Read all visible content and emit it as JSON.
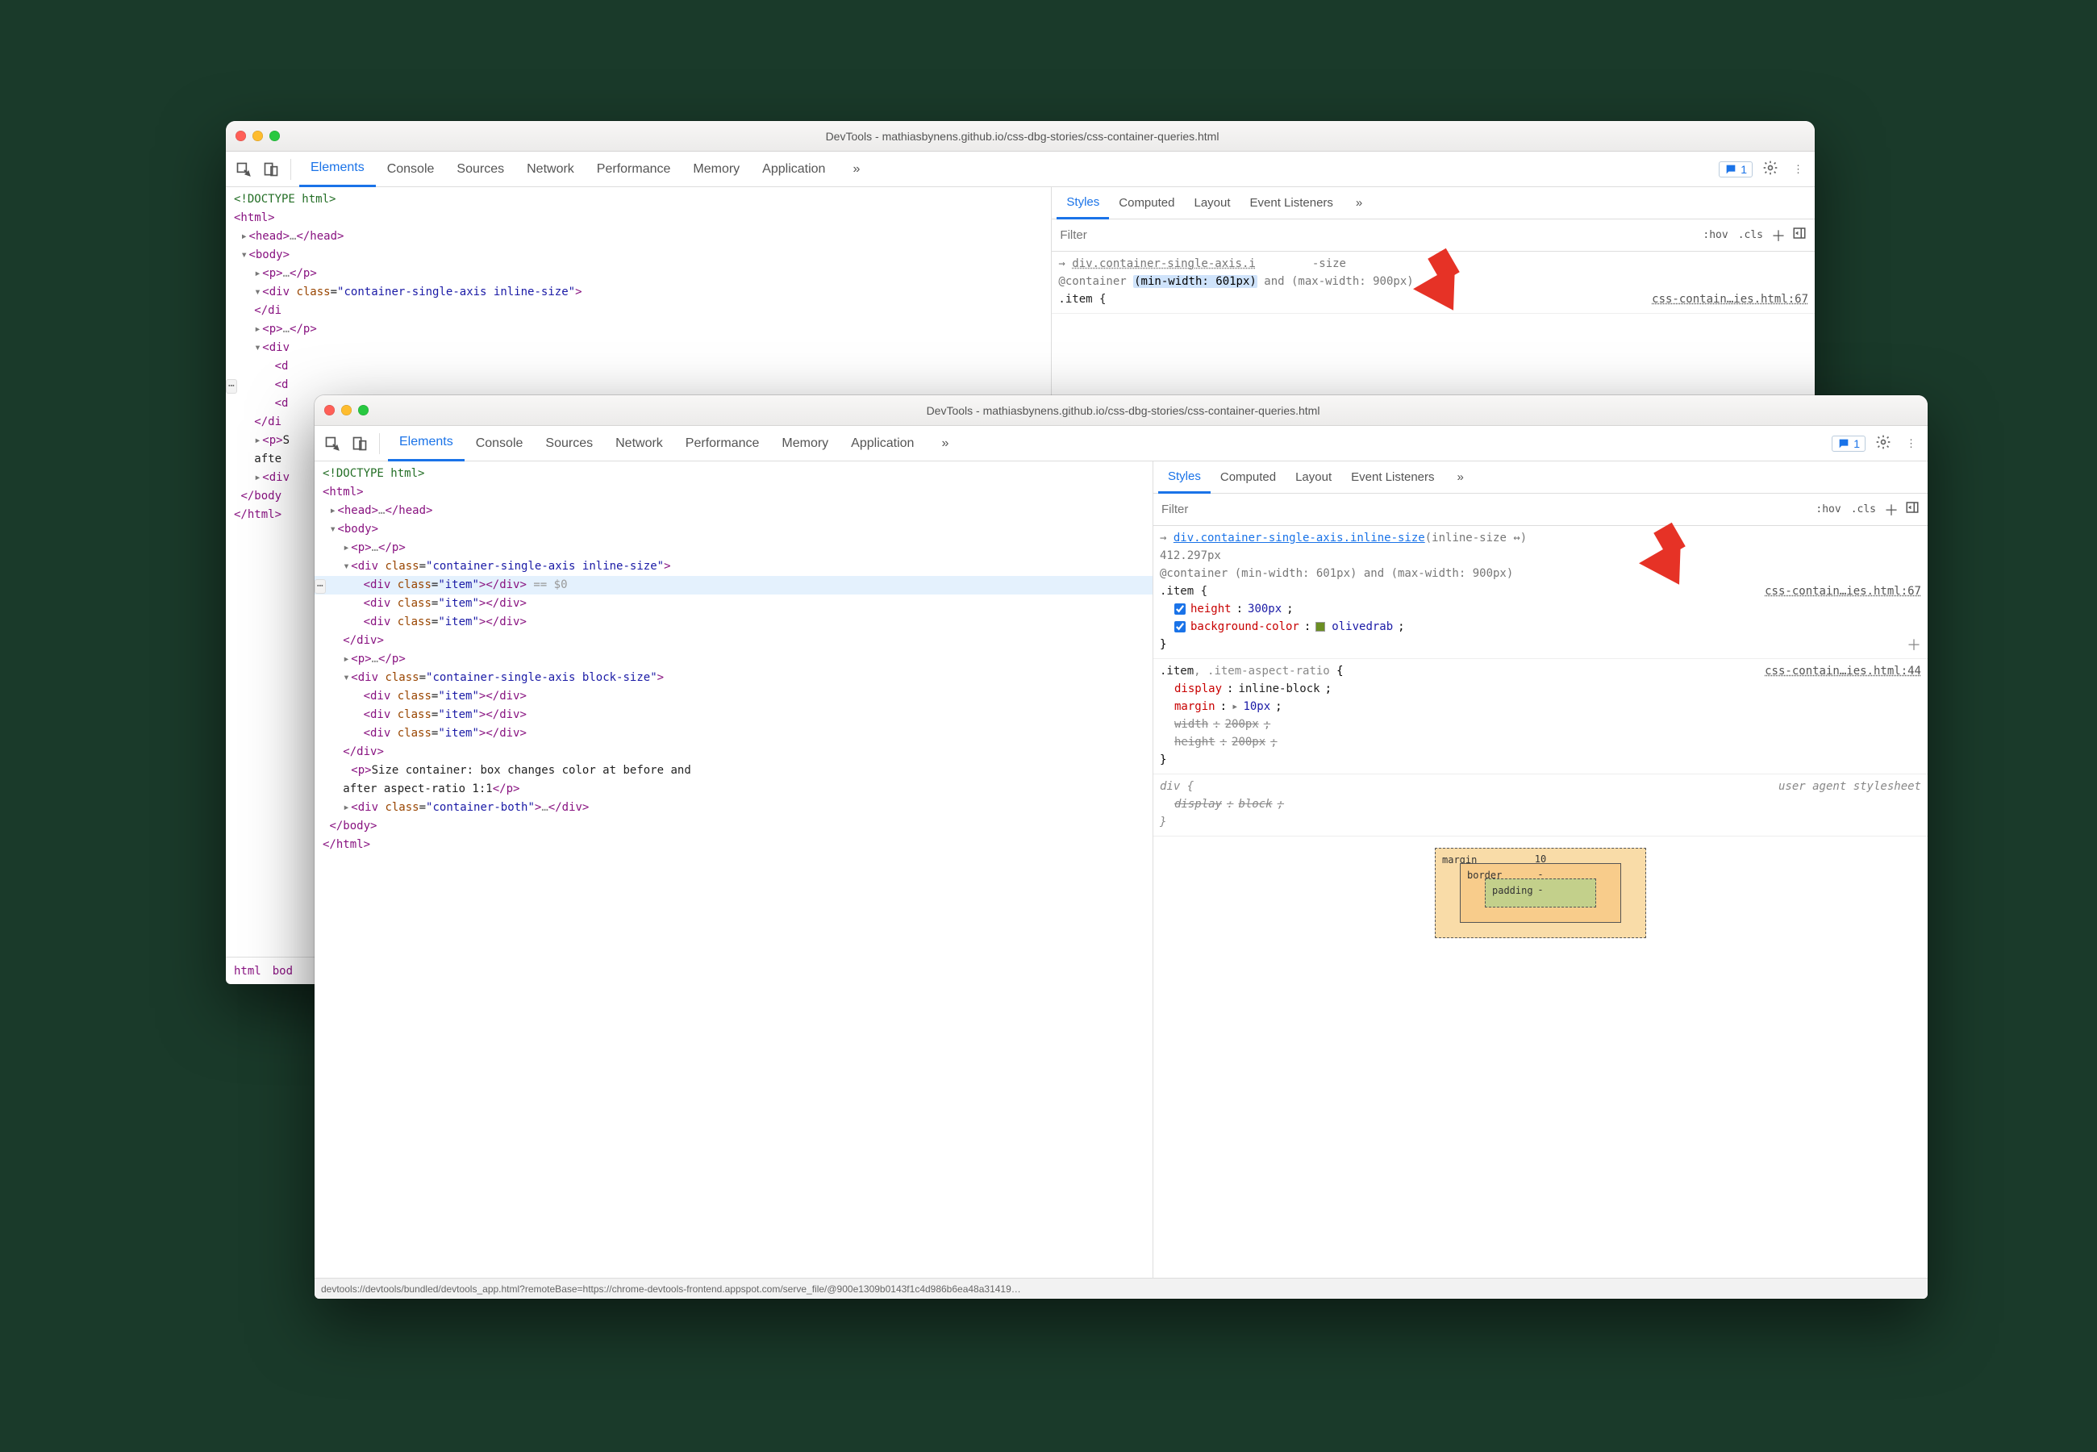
{
  "window_back": {
    "title": "DevTools - mathiasbynens.github.io/css-dbg-stories/css-container-queries.html",
    "tabs": [
      "Elements",
      "Console",
      "Sources",
      "Network",
      "Performance",
      "Memory",
      "Application"
    ],
    "active_tab": "Elements",
    "messages": "1",
    "subtabs": [
      "Styles",
      "Computed",
      "Layout",
      "Event Listeners"
    ],
    "active_subtab": "Styles",
    "filter_placeholder": "Filter",
    "hov": ":hov",
    "cls": ".cls",
    "tree": {
      "doctype": "<!DOCTYPE html>",
      "html_open": "<html>",
      "head": "<head>…</head>",
      "body_open": "<body>",
      "p_empty": "<p>…</p>",
      "div1_open": "<div class=\"container-single-axis inline-size\">",
      "close_di": "</di",
      "div_open_only": "<div",
      "close_div": "</div>",
      "p_s": "<p>S",
      "afte": "afte",
      "body_close": "</body",
      "html_close": "</html>"
    },
    "crumbs": [
      "html",
      "bod"
    ],
    "styles": {
      "origin": "div.container-single-axis.i",
      "origin_tail": "-size",
      "container_rule": "@container (min-width: 601px) and (max-width: 900px)",
      "selector_open": ".item {",
      "src": "css-contain…ies.html:67",
      "hl_fragment": "(min-width: 601px)"
    }
  },
  "window_front": {
    "title": "DevTools - mathiasbynens.github.io/css-dbg-stories/css-container-queries.html",
    "tabs": [
      "Elements",
      "Console",
      "Sources",
      "Network",
      "Performance",
      "Memory",
      "Application"
    ],
    "active_tab": "Elements",
    "messages": "1",
    "subtabs": [
      "Styles",
      "Computed",
      "Layout",
      "Event Listeners"
    ],
    "active_subtab": "Styles",
    "filter_placeholder": "Filter",
    "hov": ":hov",
    "cls": ".cls",
    "tree": {
      "doctype": "<!DOCTYPE html>",
      "html_open": "<html>",
      "head": "<head>…</head>",
      "body_open": "<body>",
      "p_empty": "<p>…</p>",
      "div1_open": "<div class=\"container-single-axis inline-size\">",
      "item_row": "<div class=\"item\"></div>",
      "eq0": " == $0",
      "item_row2": "<div class=\"item\"></div>",
      "item_row3": "<div class=\"item\"></div>",
      "div_close": "</div>",
      "p2": "<p>…</p>",
      "div2_open": "<div class=\"container-single-axis block-size\">",
      "item_row4": "<div class=\"item\"></div>",
      "item_row5": "<div class=\"item\"></div>",
      "item_row6": "<div class=\"item\"></div>",
      "p_text_a": "<p>Size container: box changes color at before and",
      "p_text_b": "after aspect-ratio 1:1</p>",
      "div3": "<div class=\"container-both\">…</div>",
      "body_close": "</body>",
      "html_close": "</html>"
    },
    "styles": {
      "origin_link": "div.container-single-axis.inline-size",
      "origin_paren": "(inline-size ↔)",
      "origin_size": "412.297px",
      "container_rule": "@container (min-width: 601px) and (max-width: 900px)",
      "rule1_sel": ".item {",
      "rule1_src": "css-contain…ies.html:67",
      "rule1_p1_k": "height",
      "rule1_p1_v": "300px",
      "rule1_p2_k": "background-color",
      "rule1_p2_v": "olivedrab",
      "brace_close": "}",
      "rule2_sel": ".item, .item-aspect-ratio {",
      "rule2_src": "css-contain…ies.html:44",
      "rule2_p1_k": "display",
      "rule2_p1_v": "inline-block",
      "rule2_p2_k": "margin",
      "rule2_p2_v": "10px",
      "rule2_p3": "width: 200px;",
      "rule2_p4": "height: 200px;",
      "rule3_sel": "div {",
      "rule3_ua": "user agent stylesheet",
      "rule3_p1": "display: block;"
    },
    "boxmodel": {
      "margin_label": "margin",
      "margin_top": "10",
      "border_label": "border",
      "border_top": "-",
      "padding_label": "padding",
      "padding_top": "-"
    },
    "status": "devtools://devtools/bundled/devtools_app.html?remoteBase=https://chrome-devtools-frontend.appspot.com/serve_file/@900e1309b0143f1c4d986b6ea48a31419…"
  },
  "overflow_glyph": "»",
  "ellipsis_glyph": "⋯",
  "resize_glyph": "↔"
}
